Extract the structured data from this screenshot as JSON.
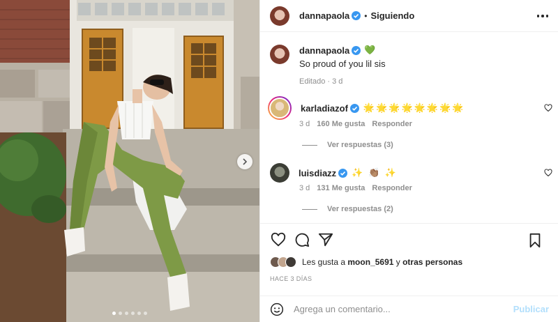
{
  "post": {
    "author": "dannapaola",
    "dot": "•",
    "follow_status": "Siguiendo"
  },
  "caption": {
    "author": "dannapaola",
    "emoji": "💚",
    "text": "So proud of you lil sis",
    "edited": "Editado · 3 d"
  },
  "comments": [
    {
      "user": "karladiazof",
      "text": "🌟🌟🌟🌟🌟🌟🌟🌟",
      "age": "3 d",
      "likes": "160 Me gusta",
      "reply": "Responder",
      "view_replies": "Ver respuestas (3)"
    },
    {
      "user": "luisdiazz",
      "text": "✨ 👏🏽 ✨",
      "age": "3 d",
      "likes": "131 Me gusta",
      "reply": "Responder",
      "view_replies": "Ver respuestas (2)"
    }
  ],
  "likes": {
    "prefix": "Les gusta a ",
    "user": "moon_5691",
    "middle": " y ",
    "others": "otras personas"
  },
  "timestamp": "HACE 3 DÍAS",
  "comment_box": {
    "placeholder": "Agrega un comentario...",
    "publish": "Publicar"
  },
  "carousel": {
    "slides": 6,
    "active_index": 0
  },
  "icons": {
    "verified": "verified-badge-icon",
    "more": "more-options-icon",
    "heart": "heart-icon",
    "comment": "comment-icon",
    "share": "share-icon",
    "save": "bookmark-icon",
    "emoji": "smile-icon",
    "next": "chevron-right-icon"
  },
  "colors": {
    "verified": "#3897f0",
    "publish": "#b2dffc",
    "muted": "#8e8e8e",
    "text": "#262626"
  }
}
